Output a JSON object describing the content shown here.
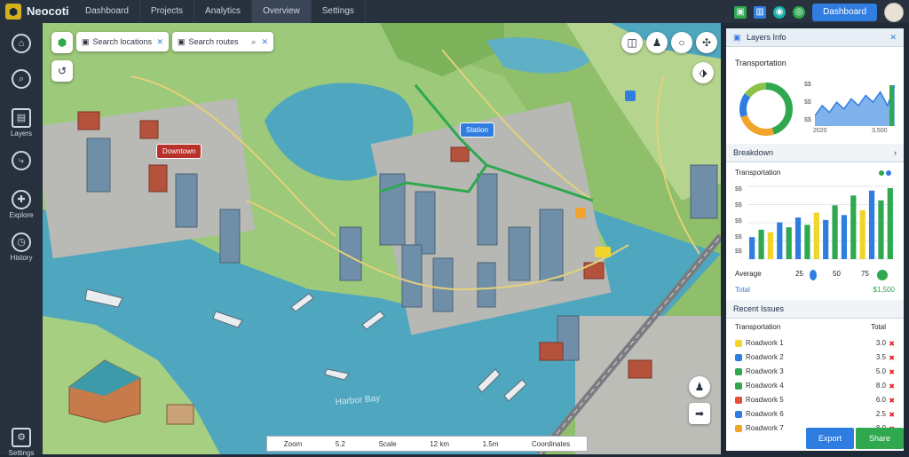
{
  "app": {
    "name": "Neocoti"
  },
  "tabs": [
    "Dashboard",
    "Projects",
    "Analytics",
    "Overview",
    "Settings"
  ],
  "topbar": {
    "button_label": "Dashboard"
  },
  "sidebar": [
    {
      "icon": "home-icon",
      "label": ""
    },
    {
      "icon": "search-icon",
      "label": ""
    },
    {
      "icon": "layers-icon",
      "label": "Layers"
    },
    {
      "icon": "routes-icon",
      "label": ""
    },
    {
      "icon": "compass-icon",
      "label": "Explore"
    },
    {
      "icon": "clock-icon",
      "label": "History"
    },
    {
      "icon": "settings-icon",
      "label": "Settings"
    }
  ],
  "map": {
    "search1": {
      "placeholder": "Search locations"
    },
    "search2": {
      "placeholder": "Search routes"
    },
    "labels": {
      "district": "Downtown",
      "marker": "Station",
      "water_label": "Harbor Bay"
    },
    "status": {
      "item1": "Zoom",
      "item2": "5.2",
      "item3": "Scale",
      "item4": "12 km",
      "item5": "1.5m",
      "item6": "Coordinates"
    }
  },
  "panel": {
    "header": "Layers Info",
    "section1_title": "Transportation",
    "donut": {
      "values": [
        45,
        25,
        15,
        15
      ],
      "colors": [
        "#2fa84f",
        "#f2a32b",
        "#2f7de1",
        "#8bc34a"
      ]
    },
    "spark": {
      "axis_top": "$$",
      "axis_mid": "$$",
      "axis_bottom": "$$",
      "x_left": "2020",
      "x_right": "3,500",
      "values": [
        3,
        6,
        4,
        7,
        5,
        8,
        6,
        9,
        7,
        10,
        6,
        12
      ]
    },
    "section2_title": "Breakdown",
    "bars_title": "Transportation",
    "bar_axis": [
      "$$",
      "$$",
      "$$",
      "$$",
      "$$"
    ],
    "bars": {
      "values": [
        18,
        24,
        22,
        30,
        26,
        34,
        28,
        38,
        32,
        44,
        36,
        52,
        40,
        56,
        48,
        58
      ],
      "colors": [
        "#2f7de1",
        "#2fa84f",
        "#f2d52b",
        "#2f7de1",
        "#2fa84f",
        "#2f7de1",
        "#2fa84f",
        "#f2d52b",
        "#2f7de1",
        "#2fa84f",
        "#2f7de1",
        "#2fa84f",
        "#f2d52b",
        "#2f7de1",
        "#2fa84f",
        "#2fa84f"
      ]
    },
    "summary": {
      "label": "Average",
      "v1": "25",
      "v2": "50",
      "v3": "75",
      "total": "Total",
      "total_val": "$1,500"
    },
    "section3_title": "Recent Issues",
    "list_header": {
      "left": "Transportation",
      "right": "Total"
    },
    "list": [
      {
        "color": "#f2d52b",
        "name": "Roadwork 1",
        "value": "3.0"
      },
      {
        "color": "#2f7de1",
        "name": "Roadwork 2",
        "value": "3.5"
      },
      {
        "color": "#2fa84f",
        "name": "Roadwork 3",
        "value": "5.0"
      },
      {
        "color": "#2fa84f",
        "name": "Roadwork 4",
        "value": "8.0"
      },
      {
        "color": "#e74c3c",
        "name": "Roadwork 5",
        "value": "6.0"
      },
      {
        "color": "#2f7de1",
        "name": "Roadwork 6",
        "value": "2.5"
      },
      {
        "color": "#f2a32b",
        "name": "Roadwork 7",
        "value": "8.0"
      }
    ],
    "buttons": {
      "primary": "Export",
      "secondary": "Share"
    }
  }
}
